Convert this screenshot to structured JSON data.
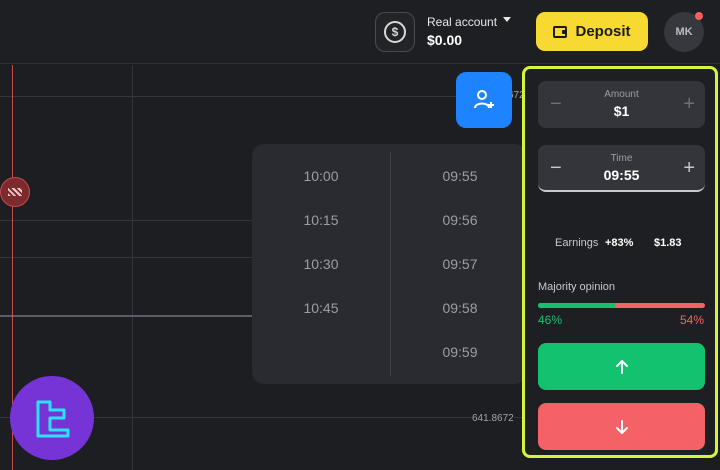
{
  "header": {
    "account_name": "Real account",
    "account_balance": "$0.00",
    "deposit_label": "Deposit",
    "avatar_initials": "MK"
  },
  "chart": {
    "axis_labels": [
      "672",
      "641.8672"
    ],
    "invite_icon": "add-user-icon"
  },
  "time_picker": {
    "left_options": [
      "10:00",
      "10:15",
      "10:30",
      "10:45"
    ],
    "right_options": [
      "09:55",
      "09:56",
      "09:57",
      "09:58",
      "09:59"
    ]
  },
  "trade_panel": {
    "amount_label": "Amount",
    "amount_value": "$1",
    "time_label": "Time",
    "time_value": "09:55",
    "minus_symbol": "−",
    "plus_symbol": "+",
    "earnings_label": "Earnings",
    "earnings_pct": "+83%",
    "earnings_value": "$1.83",
    "majority_label": "Majority opinion",
    "majority_up": "46%",
    "majority_down": "54%",
    "majority_up_fraction": 0.46
  },
  "colors": {
    "accent_yellow": "#f8d932",
    "up_green": "#13c26f",
    "down_red": "#f46268",
    "invite_blue": "#1d83ff",
    "highlight": "#d6f53a",
    "logo_purple": "#7634d6"
  }
}
